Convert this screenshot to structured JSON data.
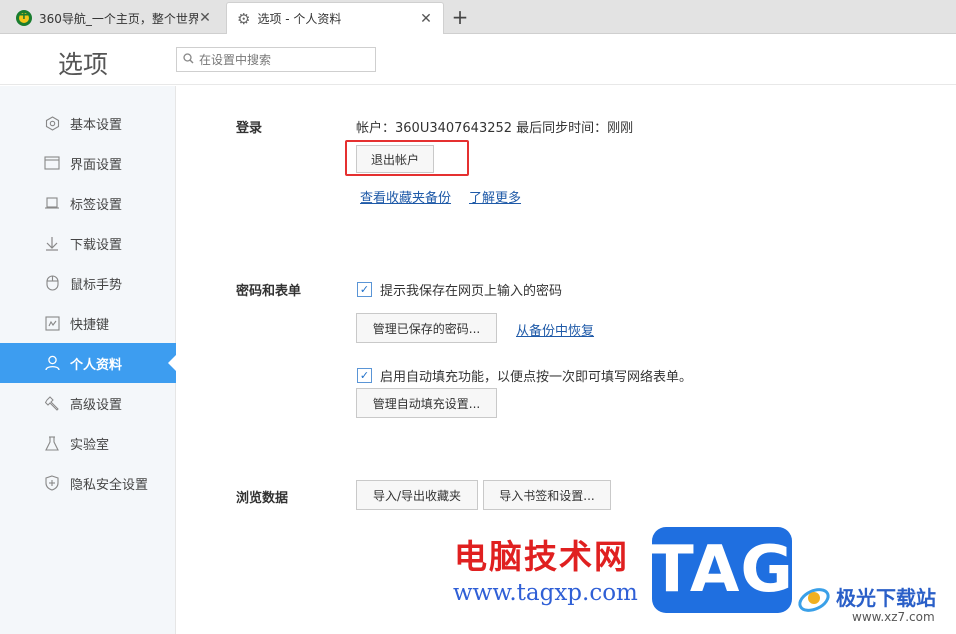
{
  "tabs": [
    {
      "title": "360导航_一个主页，整个世界",
      "close": "✕"
    },
    {
      "title": "选项 - 个人资料",
      "close": "✕"
    }
  ],
  "new_tab": "+",
  "header": {
    "title": "选项",
    "search_placeholder": "在设置中搜索"
  },
  "sidebar": {
    "items": [
      {
        "label": "基本设置",
        "icon": "hexagon-icon"
      },
      {
        "label": "界面设置",
        "icon": "window-icon"
      },
      {
        "label": "标签设置",
        "icon": "tab-icon"
      },
      {
        "label": "下载设置",
        "icon": "download-icon"
      },
      {
        "label": "鼠标手势",
        "icon": "mouse-icon"
      },
      {
        "label": "快捷键",
        "icon": "keyboard-icon"
      },
      {
        "label": "个人资料",
        "icon": "user-icon",
        "active": true
      },
      {
        "label": "高级设置",
        "icon": "wrench-icon"
      },
      {
        "label": "实验室",
        "icon": "flask-icon"
      },
      {
        "label": "隐私安全设置",
        "icon": "shield-icon"
      }
    ]
  },
  "login": {
    "label": "登录",
    "account_text": "帐户：360U3407643252  最后同步时间：刚刚",
    "logout_button": "退出帐户",
    "view_backup_link": "查看收藏夹备份",
    "learn_more_link": "了解更多"
  },
  "passwords": {
    "label": "密码和表单",
    "save_prompt_label": "提示我保存在网页上输入的密码",
    "save_prompt_checked": true,
    "manage_passwords_button": "管理已保存的密码...",
    "restore_link": "从备份中恢复",
    "autofill_label": "启用自动填充功能，以便点按一次即可填写网络表单。",
    "autofill_checked": true,
    "manage_autofill_button": "管理自动填充设置..."
  },
  "browsing": {
    "label": "浏览数据",
    "import_export_button": "导入/导出收藏夹",
    "import_bookmarks_button": "导入书签和设置..."
  },
  "watermark": {
    "site_name": "电脑技术网",
    "url": "www.tagxp.com",
    "tag": "TAG",
    "dl_name": "极光下载站",
    "dl_url": "www.xz7.com"
  },
  "colors": {
    "accent": "#3d9df0",
    "highlight_border": "#e53030",
    "link": "#1f5aa8"
  }
}
